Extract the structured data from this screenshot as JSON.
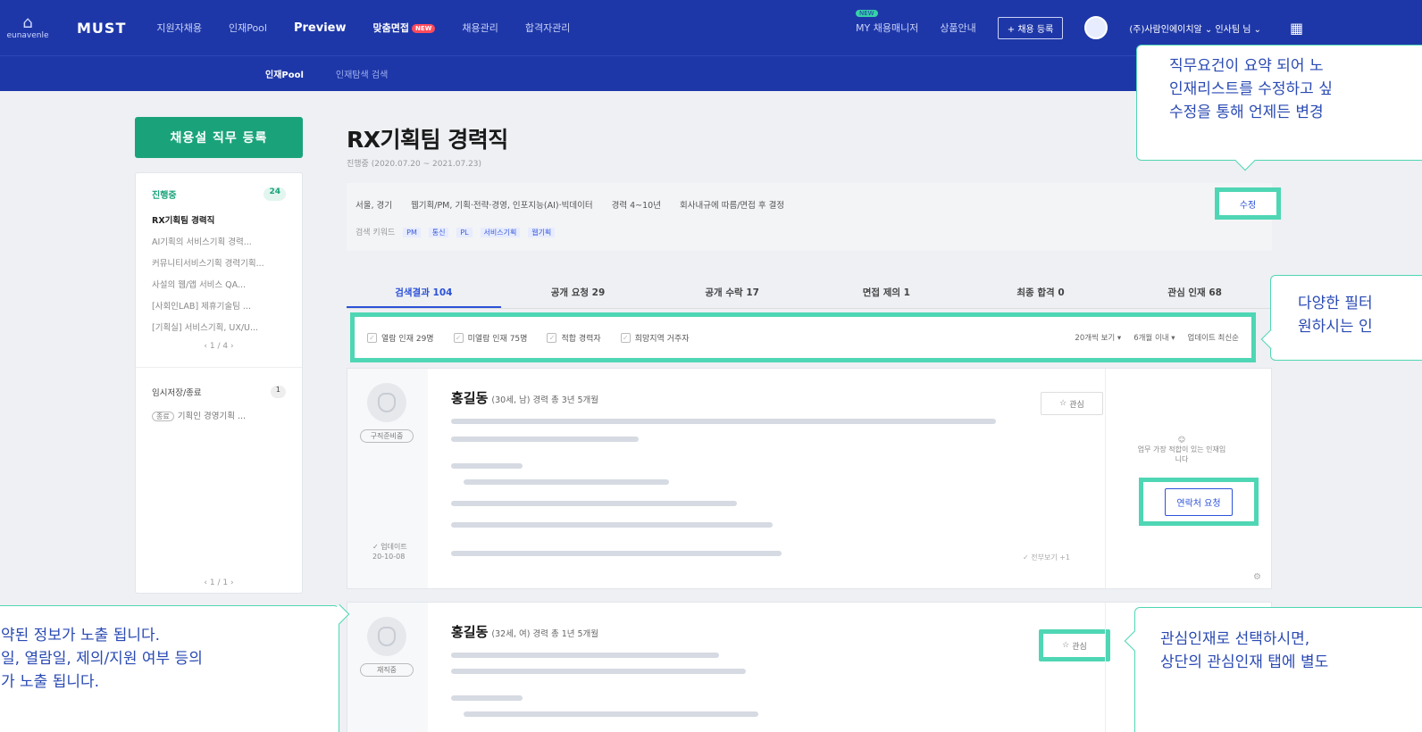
{
  "header": {
    "home_label": "eunavenle",
    "brand": "MUST",
    "nav": [
      "지원자채용",
      "인재Pool",
      "Preview",
      "맞춤면접",
      "채용관리",
      "합격자관리"
    ],
    "new_badge": "NEW",
    "my_tag": "NEW",
    "my_manager": "MY 채용매니저",
    "product_info": "상품안내",
    "register_button": "+ 채용 등록",
    "company": "(주)사람인에이치알 ⌄  인사팀 님 ⌄"
  },
  "subnav": {
    "active": "인재Pool",
    "second": "인재탐색 검색"
  },
  "sidebar": {
    "register_button": "채용설 직무 등록",
    "ongoing_label": "진행중",
    "ongoing_count": "24",
    "items": [
      "RX기획팀 경력직",
      "AI기획의 서비스기획 경력...",
      "커뮤니티서비스기획 경력기획...",
      "사설의 웹/앱 서비스 QA...",
      "[사회인LAB] 제휴기술팀 ...",
      "[기획실] 서비스기획, UX/U..."
    ],
    "pager": "‹  1 / 4  ›",
    "temp_label": "임시저장/종료",
    "temp_count": "1",
    "temp_chip": "종료",
    "temp_item": "기획인 경영기획 ...",
    "pager2": "‹  1 / 1  ›"
  },
  "job": {
    "title": "RX기획팀 경력직",
    "period": "진행중 (2020.07.20 ~ 2021.07.23)",
    "requirements": [
      "서울, 경기",
      "웹기획/PM, 기획·전략·경영, 인포지능(AI)·빅데이터",
      "경력 4~10년",
      "회사내규에 따름/면접 후 결정"
    ],
    "keyword_label": "검색 키워드",
    "keywords": [
      "PM",
      "통신",
      "PL",
      "서비스기획",
      "웹기획"
    ],
    "edit_button": "수정"
  },
  "tabs": [
    "검색결과 104",
    "공개 요청 29",
    "공개 수락 17",
    "면접 제의 1",
    "최종 합격 0",
    "관심 인재 68"
  ],
  "filters": {
    "checks": [
      "열람 인재 29명",
      "미열람 인재 75명",
      "적합 경력자",
      "희망지역 거주자"
    ],
    "per_page": "20개씩 보기",
    "period": "6개월 이내",
    "sort": "업데이트 최신순"
  },
  "candidates": [
    {
      "name": "홍길동",
      "meta": "(30세, 남) 경력 총 3년 5개월",
      "status": "구직준비중",
      "date_label": "✓ 업데이트",
      "date": "20-10-08",
      "interest": "관심",
      "note": "업무 가장 적합이 있는 인재입니다",
      "contact_button": "연락처 요청",
      "more": "✓ 전부보기 +1"
    },
    {
      "name": "홍길동",
      "meta": "(32세, 여) 경력 총 1년 5개월",
      "status": "재직중",
      "interest": "관심"
    }
  ],
  "callouts": {
    "c1": [
      "직무요건이 요약 되어 노",
      "인재리스트를 수정하고 싶",
      "수정을 통해 언제든 변경"
    ],
    "c2": [
      "다양한 필터",
      "원하시는 인"
    ],
    "c3": [
      "약된 정보가 노출 됩니다.",
      "일, 열람일, 제의/지원 여부 등의",
      "가 노출 됩니다."
    ],
    "c4": [
      "관심인재로 선택하시면,",
      "상단의 관심인재 탭에 별도"
    ]
  },
  "colors": {
    "nav": "#1e37a8",
    "accent": "#4fd6b4",
    "primary": "#1aa37a",
    "link": "#2c52d9"
  }
}
